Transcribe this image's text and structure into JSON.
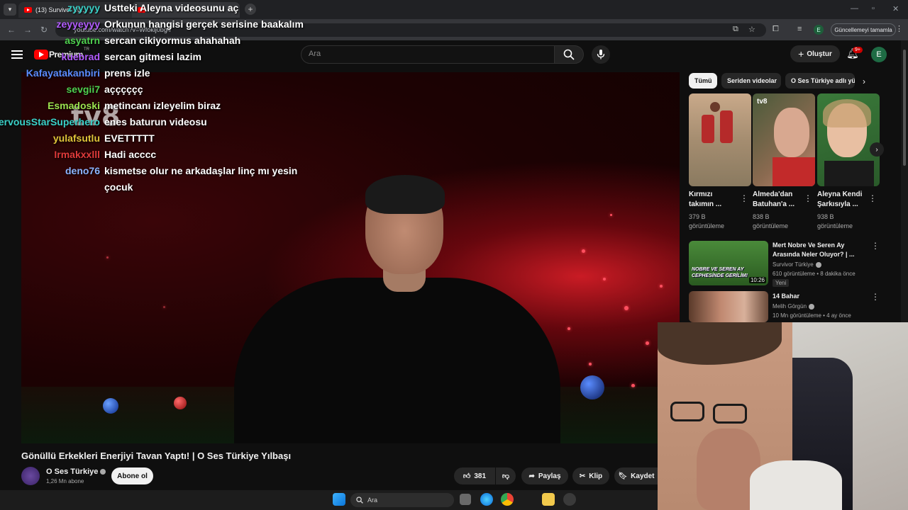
{
  "browser": {
    "tabs": [
      {
        "label": "(13) Survivor 20..."
      },
      {
        "label": "Ustteki Aleyna videosunu aç"
      }
    ],
    "url": "youtube.com/watch?v=Wfoklj0bg4",
    "update_label": "Güncellemeyi tamamla",
    "profile_initial": "E"
  },
  "yt": {
    "logo_text": "Premium",
    "logo_region": "TR",
    "search_placeholder": "Ara",
    "create_label": "Oluştur",
    "notif_badge": "9+",
    "avatar_initial": "E"
  },
  "chat": [
    {
      "user": "zyyyyy",
      "color": "#3ad1c8",
      "msg": "Ustteki Aleyna videosunu aç"
    },
    {
      "user": "zeyyeyyy",
      "color": "#b35cff",
      "msg": "Orkunun hangisi gerçek serisine baakalım"
    },
    {
      "user": "asyatrn",
      "color": "#4fd14f",
      "msg": "sercan cikiyormus ahahahah"
    },
    {
      "user": "kuebrad",
      "color": "#b35cff",
      "msg": "sercan gitmesi lazim"
    },
    {
      "user": "Kafayatakanbiri",
      "color": "#5a8cff",
      "msg": "prens izle"
    },
    {
      "user": "sevgii7",
      "color": "#4fd14f",
      "msg": "açççççç"
    },
    {
      "user": "Esmadoski",
      "color": "#9be34f",
      "msg": "metincanı izleyelim biraz"
    },
    {
      "user": "NervousStarSuperhero",
      "color": "#3ad1c8",
      "msg": "enes baturun videosu"
    },
    {
      "user": "yulafsutlu",
      "color": "#e0c53a",
      "msg": "EVETTTTT"
    },
    {
      "user": "Irmakxxlll",
      "color": "#e03a3a",
      "msg": "Hadi acccc"
    },
    {
      "user": "deno76",
      "color": "#8cb4ff",
      "msg": "kismetse olur ne arkadaşlar linç mı yesin"
    },
    {
      "user": "",
      "color": "#ffffff",
      "msg": "çocuk"
    }
  ],
  "video": {
    "title": "Gönüllü Erkekleri Enerjiyi Tavan Yaptı! | O Ses Türkiye Yılbaşı",
    "channel": "O Ses Türkiye",
    "subscribers": "1,26 Mn abone",
    "subscribe_label": "Abone ol",
    "likes": "381",
    "share_label": "Paylaş",
    "clip_label": "Klip",
    "save_label": "Kaydet",
    "logo_bug": "tv8"
  },
  "sidebar": {
    "chips": [
      "Tümü",
      "Seriden videolar",
      "O Ses Türkiye adlı yükleyiciden"
    ],
    "shorts": [
      {
        "title": "Kırmızı takımın ...",
        "views": "379 B görüntüleme"
      },
      {
        "title": "Almeda'dan Batuhan'a ...",
        "views": "838 B görüntüleme"
      },
      {
        "title": "Aleyna Kendi Şarkısıyla ...",
        "views": "938 B görüntüleme"
      }
    ],
    "recs": [
      {
        "title": "Mert Nobre Ve Seren Ay Arasında Neler Oluyor? | ...",
        "channel": "Survivor Türkiye",
        "meta": "610 görüntüleme • 8 dakika önce",
        "duration": "10:26",
        "tag": "Yeni",
        "thumb_text": "NOBRE VE SEREN AY CEPHESİNDE GERİLİM!"
      },
      {
        "title": "14 Bahar",
        "channel": "Melih Görgün",
        "meta": "10 Mn görüntüleme • 4 ay önce"
      }
    ]
  },
  "taskbar": {
    "search_placeholder": "Ara"
  }
}
